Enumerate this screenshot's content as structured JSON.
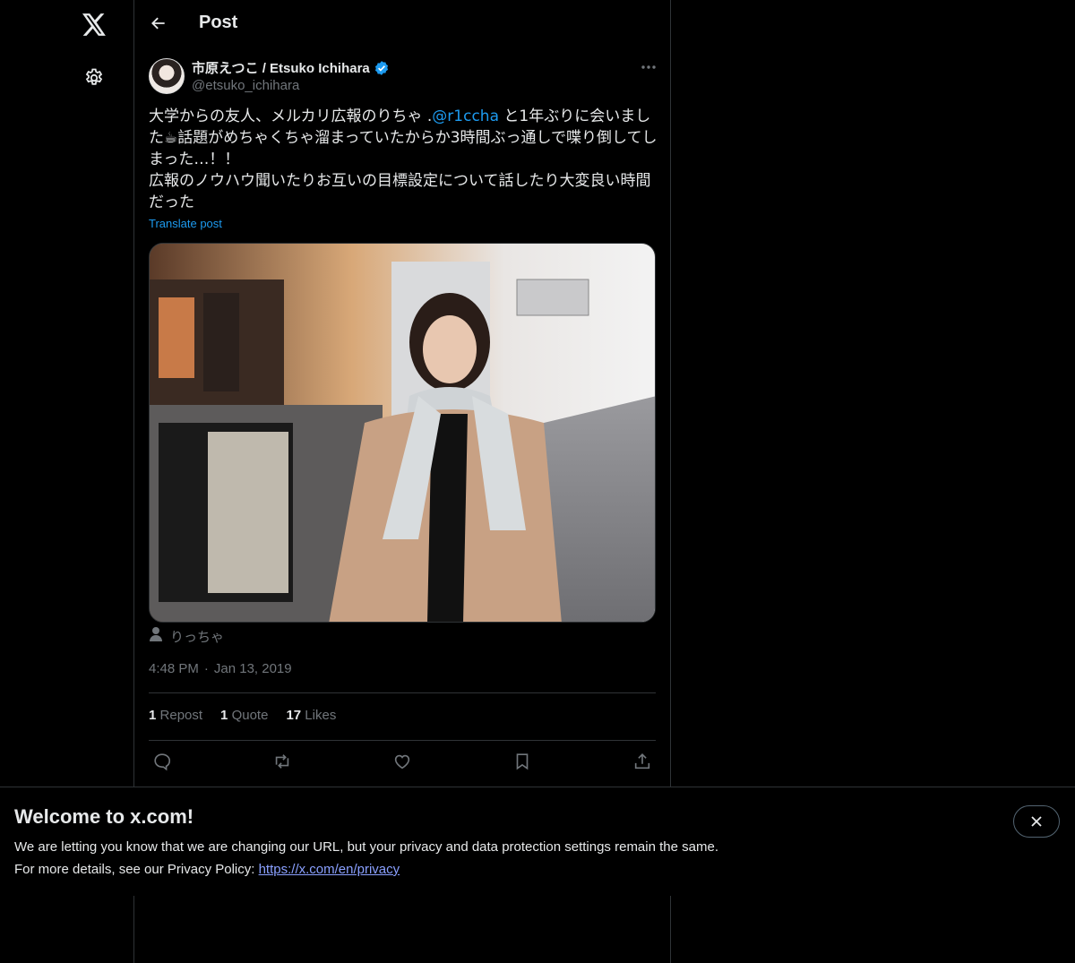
{
  "nav": {
    "logo_icon": "x-logo-icon",
    "settings_icon": "gear-icon"
  },
  "header": {
    "title": "Post",
    "back_icon": "arrow-left-icon"
  },
  "post": {
    "display_name": "市原えつこ / Etsuko Ichihara",
    "handle": "@etsuko_ichihara",
    "verified": true,
    "text_part1": "大学からの友人、メルカリ広報のりちゃ .",
    "mention": "@r1ccha",
    "text_part2": " と1年ぶりに会いました☕話題がめちゃくちゃ溜まっていたからか3時間ぶっ通しで喋り倒してしまった…！！",
    "text_part3": "広報のノウハウ聞いたりお互いの目標設定について話したり大変良い時間だった",
    "translate_label": "Translate post",
    "tagged_user": "りっちゃ",
    "time": "4:48 PM",
    "separator": "·",
    "date": "Jan 13, 2019",
    "stats": {
      "reposts_count": "1",
      "reposts_label": "Repost",
      "quotes_count": "1",
      "quotes_label": "Quote",
      "likes_count": "17",
      "likes_label": "Likes"
    }
  },
  "banner": {
    "title": "Welcome to x.com!",
    "line1": "We are letting you know that we are changing our URL, but your privacy and data protection settings remain the same.",
    "line2_prefix": "For more details, see our Privacy Policy: ",
    "link_text": "https://x.com/en/privacy"
  },
  "colors": {
    "background": "#000000",
    "text": "#e7e9ea",
    "muted": "#71767b",
    "accent": "#1d9bf0",
    "border": "#2f3336"
  }
}
